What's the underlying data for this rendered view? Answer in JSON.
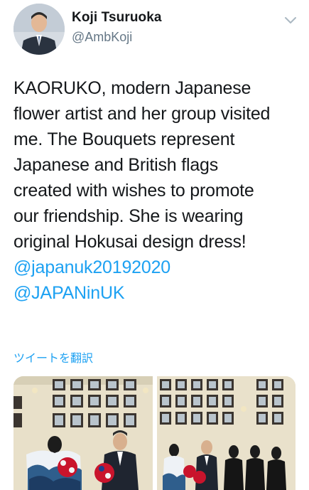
{
  "author": {
    "name": "Koji Tsuruoka",
    "handle": "@AmbKoji"
  },
  "tweet": {
    "lines": [
      "KAORUKO, modern Japanese",
      "flower artist and her group visited",
      "me. The Bouquets represent",
      "Japanese and British flags",
      "created with wishes to promote",
      "our friendship. She is wearing",
      "original Hokusai design dress!"
    ],
    "mentions": [
      "@japanuk20192020",
      "@JAPANinUK"
    ]
  },
  "translate_label": "ツイートを翻訳",
  "icons": {
    "menu": "chevron-down-icon"
  },
  "colors": {
    "link": "#1da1f2",
    "secondary": "#657786",
    "text": "#14171a"
  }
}
